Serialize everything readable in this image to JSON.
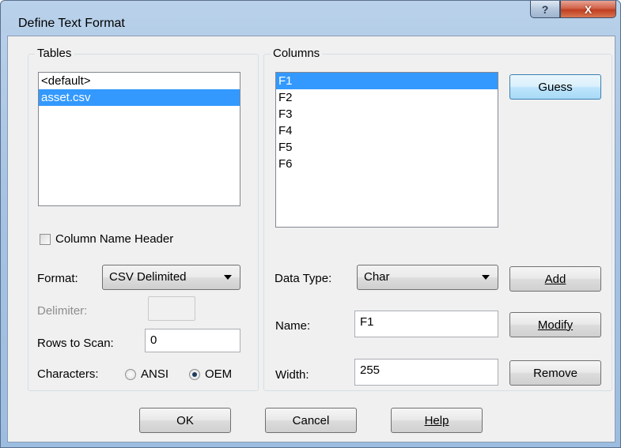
{
  "window": {
    "title": "Define Text Format",
    "help_glyph": "?",
    "close_glyph": "X"
  },
  "tables": {
    "label": "Tables",
    "items": [
      "<default>",
      "asset.csv"
    ],
    "selected_index": 1
  },
  "options": {
    "column_name_header_label": "Column Name Header",
    "column_name_header_checked": false,
    "format_label": "Format:",
    "format_value": "CSV Delimited",
    "delimiter_label": "Delimiter:",
    "delimiter_value": "",
    "rows_to_scan_label": "Rows to Scan:",
    "rows_to_scan_value": "0",
    "characters_label": "Characters:",
    "ansi_label": "ANSI",
    "oem_label": "OEM",
    "characters_selected": "OEM"
  },
  "columns": {
    "label": "Columns",
    "items": [
      "F1",
      "F2",
      "F3",
      "F4",
      "F5",
      "F6"
    ],
    "selected_index": 0,
    "guess_label": "Guess",
    "data_type_label": "Data Type:",
    "data_type_value": "Char",
    "name_label": "Name:",
    "name_value": "F1",
    "width_label": "Width:",
    "width_value": "255",
    "add_label": "Add",
    "modify_label": "Modify",
    "remove_label": "Remove"
  },
  "footer": {
    "ok_label": "OK",
    "cancel_label": "Cancel",
    "help_label": "Help"
  },
  "colors": {
    "selection": "#3399ff",
    "client_bg": "#f0f0f0",
    "frame": "#a6c3e4",
    "close": "#c03e22"
  }
}
